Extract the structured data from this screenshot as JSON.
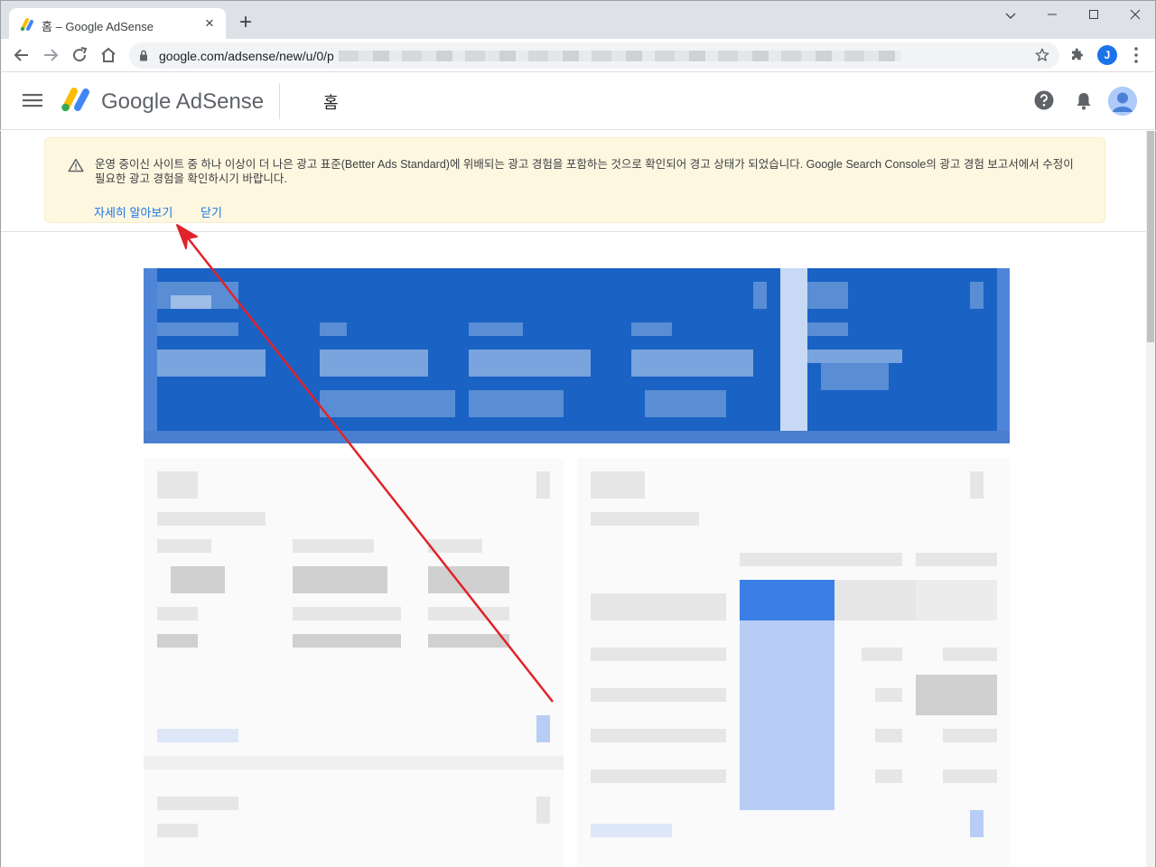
{
  "browser": {
    "tab_title": "홈 – Google AdSense",
    "url_text": "google.com/adsense/new/u/0/p",
    "profile_initial": "J"
  },
  "app": {
    "product_name": "Google AdSense",
    "page_title": "홈"
  },
  "warning": {
    "message": "운영 중이신 사이트 중 하나 이상이 더 나은 광고 표준(Better Ads Standard)에 위배되는 광고 경험을 포함하는 것으로 확인되어 경고 상태가 되었습니다. Google Search Console의 광고 경험 보고서에서 수정이 필요한 광고 경험을 확인하시기 바랍니다.",
    "learn_more": "자세히 알아보기",
    "close": "닫기"
  },
  "colors": {
    "accent": "#1a73e8",
    "banner_bg": "#fef7e0",
    "annotation_arrow": "#e0232b",
    "hero_blue": "#1a62c4"
  },
  "icons": [
    "adsense-favicon-icon",
    "close-icon",
    "plus-icon",
    "minimize-icon",
    "maximize-icon",
    "close-window-icon",
    "back-icon",
    "forward-icon",
    "reload-icon",
    "home-icon",
    "lock-icon",
    "star-icon",
    "puzzle-icon",
    "kebab-menu-icon",
    "hamburger-icon",
    "adsense-logo-icon",
    "help-icon",
    "bell-icon",
    "account-avatar-icon",
    "warning-icon"
  ]
}
